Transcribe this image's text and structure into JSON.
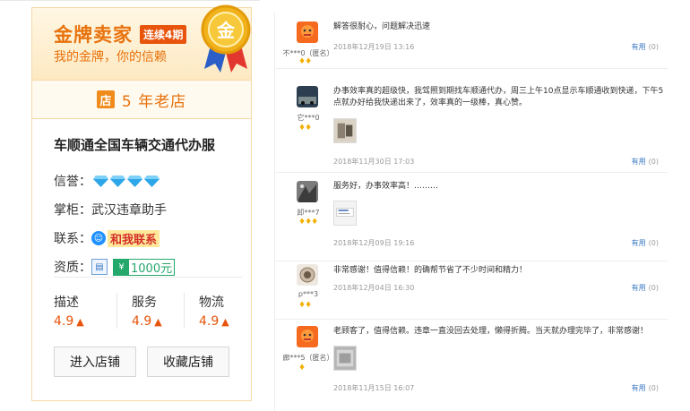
{
  "shop": {
    "gold_title": "金牌卖家",
    "streak_badge": "连续4期",
    "slogan": "我的金牌，你的信赖",
    "medal_label": "金",
    "years_icon": "店",
    "years": "5 年老店",
    "name": "车顺通全国车辆交通代办服",
    "credit_label": "信誉：",
    "credit_diamonds": 4,
    "keeper_label": "掌柜：",
    "keeper": "武汉违章助手",
    "contact_label": "联系：",
    "contact_link": "和我联系",
    "qualification_label": "资质：",
    "deposit": "1000元",
    "scores": [
      {
        "label": "描述",
        "value": "4.9"
      },
      {
        "label": "服务",
        "value": "4.9"
      },
      {
        "label": "物流",
        "value": "4.9"
      }
    ],
    "enter_button": "进入店铺",
    "favorite_button": "收藏店铺",
    "colors": {
      "accent": "#e8720c",
      "score": "#e8540c",
      "border": "#f5d9a8"
    }
  },
  "reviews": [
    {
      "user": "不***0（匿名）",
      "rank": "♦♦",
      "text": "解答很耐心，问题解决迅速",
      "time": "2018年12月19日 13:16",
      "useful_label": "有用",
      "useful_count": "(0)",
      "has_image": false
    },
    {
      "user": "它***0",
      "rank": "♦♦",
      "text": "办事效率真的超级快，我驾照到期找车顺通代办，周三上午10点显示车顺通收到快递，下午5点就办好给我快递出来了，效率真的一级棒，真心赞。",
      "time": "2018年11月30日 17:03",
      "useful_label": "有用",
      "useful_count": "(0)",
      "has_image": true
    },
    {
      "user": "卸***7",
      "rank": "♦♦♦",
      "text": "服务好，办事效率高！………",
      "time": "2018年12月09日 19:16",
      "useful_label": "有用",
      "useful_count": "(0)",
      "has_image": true
    },
    {
      "user": "p***3",
      "rank": "♦♦",
      "text": "非常感谢！值得信赖！的确帮节省了不少时间和精力！",
      "time": "2018年12月04日 16:30",
      "useful_label": "有用",
      "useful_count": "(0)",
      "has_image": false
    },
    {
      "user": "廊***5（匿名）",
      "rank": "♦",
      "text": "老顾客了，值得信赖。违章一直没回去处理，懒得折腾。当天就办理完毕了，非常感谢！",
      "time": "2018年11月15日 16:07",
      "useful_label": "有用",
      "useful_count": "(0)",
      "has_image": true
    }
  ]
}
